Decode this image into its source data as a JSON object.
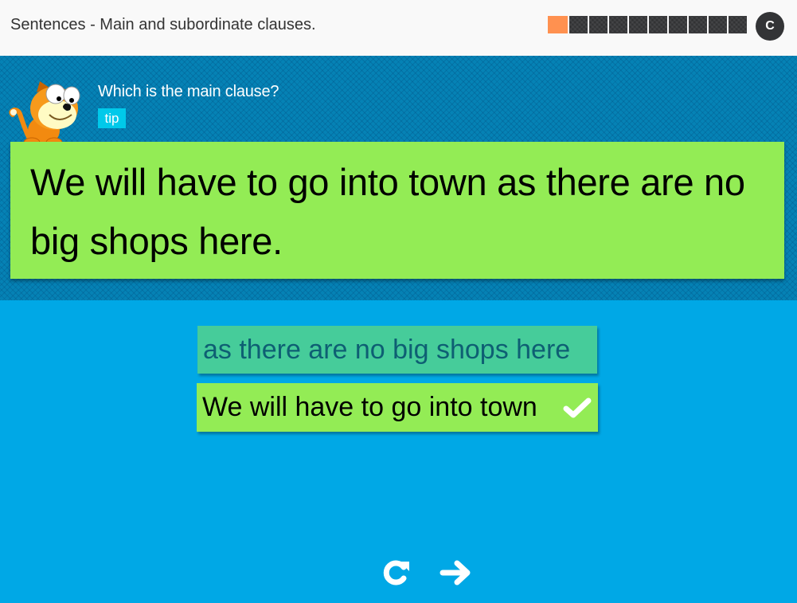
{
  "header": {
    "title": "Sentences - Main and subordinate clauses.",
    "progress": {
      "current": 1,
      "total": 10
    },
    "circle_button_label": "C"
  },
  "question": {
    "prompt": "Which is the main clause?",
    "tip_label": "tip",
    "sentence": "We will have to go into town as there are no big shops here."
  },
  "options": [
    {
      "label": "as there are no big shops here",
      "state": "unselected"
    },
    {
      "label": "We will have to go into town",
      "state": "correct"
    }
  ],
  "controls": {
    "retry_icon": "retry-icon",
    "next_icon": "arrow-right-icon"
  },
  "colors": {
    "accent_orange": "#ff9150",
    "question_bg": "#0582b5",
    "page_bg": "#00a8e6",
    "card_green": "#93ec55",
    "option_teal": "#46cc9a",
    "tip_cyan": "#00c9ea"
  }
}
